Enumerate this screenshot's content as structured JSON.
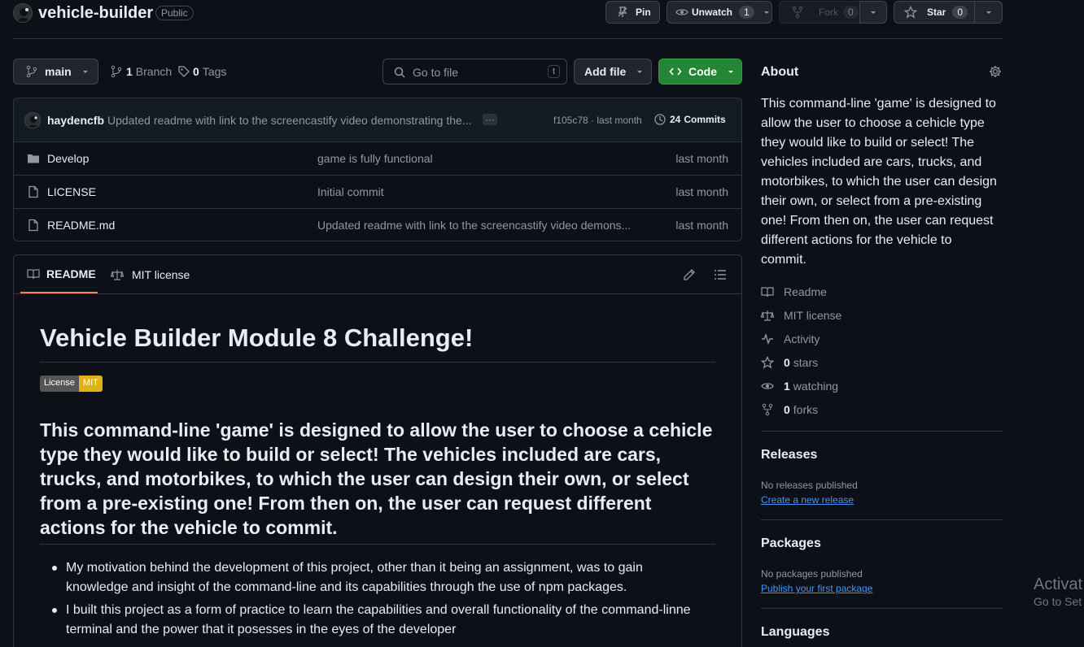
{
  "repo": {
    "name": "vehicle-builder",
    "visibility": "Public"
  },
  "header_actions": {
    "pin_label": "Pin",
    "unwatch_label": "Unwatch",
    "unwatch_count": "1",
    "fork_label": "Fork",
    "fork_count": "0",
    "star_label": "Star",
    "star_count": "0"
  },
  "toolbar": {
    "branch": "main",
    "branch_count": "1",
    "branch_label": "Branch",
    "tag_count": "0",
    "tag_label": "Tags",
    "search_placeholder": "Go to file",
    "search_shortcut": "t",
    "add_file_label": "Add file",
    "code_label": "Code"
  },
  "commit_bar": {
    "author": "haydencfb",
    "message": "Updated readme with link to the screencastify video demonstrating the...",
    "ellipsis": "···",
    "hash_time": "f105c78 · last month",
    "commits_count": "24",
    "commits_label": "Commits"
  },
  "files": [
    {
      "name": "Develop",
      "type": "folder",
      "message": "game is fully functional",
      "time": "last month"
    },
    {
      "name": "LICENSE",
      "type": "file",
      "message": "Initial commit",
      "time": "last month"
    },
    {
      "name": "README.md",
      "type": "file",
      "message": "Updated readme with link to the screencastify video demons...",
      "time": "last month"
    }
  ],
  "readme_tabs": {
    "readme": "README",
    "license": "MIT license"
  },
  "readme": {
    "title": "Vehicle Builder Module 8 Challenge!",
    "badge_left": "License",
    "badge_right": "MIT",
    "heading_lines": [
      "This command-line 'game' is designed to allow the user to choose a cehicle",
      "type they would like to build or select! The vehicles included are cars,",
      "trucks, and motorbikes, to which the user can design their own, or select",
      "from a pre-existing one! From then on, the user can request different",
      "actions for the vehicle to commit."
    ],
    "bullets": [
      [
        "My motivation behind the development of this project, other than it being an assignment, was to gain",
        "knowledge and insight of the command-line and its capabilities through the use of npm packages."
      ],
      [
        "I built this project as a form of practice to learn the capabilities and overall functionality of the command-linne",
        "terminal and the power that it posesses in the eyes of the developer"
      ]
    ]
  },
  "about": {
    "title": "About",
    "description_lines": [
      "This command-line 'game' is designed to",
      "allow the user to choose a cehicle type",
      "they would like to build or select! The",
      "vehicles included are cars, trucks, and",
      "motorbikes, to which the user can design",
      "their own, or select from a pre-existing",
      "one! From then on, the user can request",
      "different actions for the vehicle to",
      "commit."
    ],
    "readme_link": "Readme",
    "license_link": "MIT license",
    "activity_link": "Activity",
    "stars_count": "0",
    "stars_label": "stars",
    "watching_count": "1",
    "watching_label": "watching",
    "forks_count": "0",
    "forks_label": "forks"
  },
  "releases": {
    "title": "Releases",
    "status": "No releases published",
    "link": "Create a new release"
  },
  "packages": {
    "title": "Packages",
    "status": "No packages published",
    "link": "Publish your first package"
  },
  "languages": {
    "title": "Languages"
  },
  "watermark": {
    "line1": "Activat",
    "line2": "Go to Set"
  },
  "colors": {
    "background": "#0d1117",
    "code_button": "#238636",
    "link": "#4493f8",
    "badge_mit": "#dfb317",
    "tab_underline": "#f78166"
  }
}
